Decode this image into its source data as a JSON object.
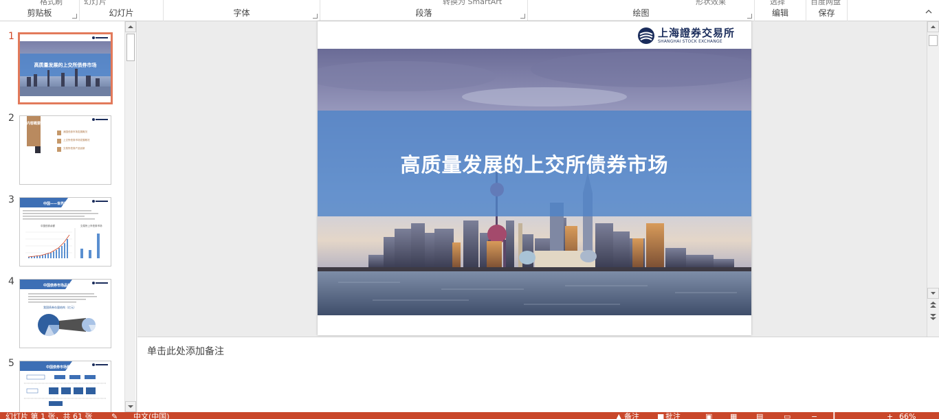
{
  "ribbon": {
    "groups": [
      {
        "id": "clipboard",
        "label": "剪贴板",
        "cut_text": "格式刷"
      },
      {
        "id": "slides",
        "label": "幻灯片",
        "cut_text": "幻灯片"
      },
      {
        "id": "font",
        "label": "字体",
        "cut_text": ""
      },
      {
        "id": "paragraph",
        "label": "段落",
        "cut_text": "转换为 SmartArt"
      },
      {
        "id": "drawing",
        "label": "绘图",
        "cut_text": "形状效果"
      },
      {
        "id": "editing",
        "label": "编辑",
        "cut_text": "选择"
      },
      {
        "id": "save",
        "label": "保存",
        "cut_text": "百度网盘"
      }
    ]
  },
  "thumbnails": {
    "items": [
      {
        "number": "1",
        "title": "高质量发展的上交所债券市场"
      },
      {
        "number": "2",
        "title": "内容概要",
        "list": [
          "我国债券市场发展概况",
          "上交所债券市场发展概况",
          "交易所债券产品创新"
        ]
      },
      {
        "number": "3",
        "title": "中国——世界第二大债券市场",
        "chart_a": "中国债券余额",
        "chart_b": "交易所上市债券市场"
      },
      {
        "number": "4",
        "title": "中国债券市场品种日益丰富",
        "chart_title": "我国债券存量结构（亿元）"
      },
      {
        "number": "5",
        "title": "中国债券市场框架结构"
      }
    ]
  },
  "slide": {
    "title": "高质量发展的上交所债券市场",
    "logo_cn": "上海證券交易所",
    "logo_en": "SHANGHAI STOCK EXCHANGE"
  },
  "notes": {
    "placeholder": "单击此处添加备注"
  },
  "status": {
    "slide_info": "幻灯片 第 1 张，共 61 张",
    "language": "中文(中国)",
    "notes_btn": "备注",
    "comments_btn": "批注",
    "zoom": "66%"
  },
  "colors": {
    "accent": "#c9472a",
    "active_thumb_border": "#e27a5b",
    "band": "#4e83c8",
    "logo": "#1a2c5b"
  }
}
